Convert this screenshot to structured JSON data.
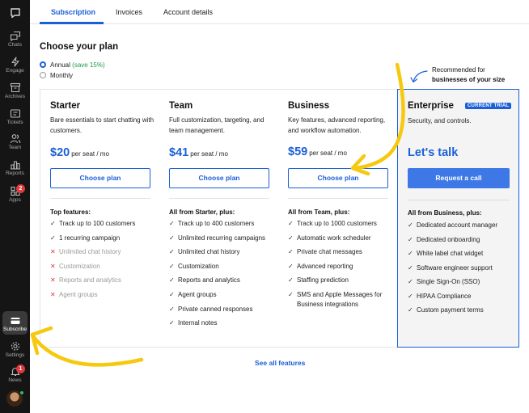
{
  "sidebar": {
    "items": [
      {
        "label": "",
        "icon": "chat-bubble-logo-icon"
      },
      {
        "label": "Chats",
        "icon": "chats-icon"
      },
      {
        "label": "Engage",
        "icon": "lightning-icon"
      },
      {
        "label": "Archives",
        "icon": "archive-icon"
      },
      {
        "label": "Tickets",
        "icon": "ticket-icon"
      },
      {
        "label": "Team",
        "icon": "team-icon"
      },
      {
        "label": "Reports",
        "icon": "bar-chart-icon"
      },
      {
        "label": "Apps",
        "icon": "apps-grid-icon",
        "badge": "2"
      },
      {
        "label": "Subscribe",
        "icon": "card-icon"
      },
      {
        "label": "Settings",
        "icon": "gear-icon"
      },
      {
        "label": "News",
        "icon": "bell-icon",
        "badge": "1"
      }
    ]
  },
  "tabs": [
    {
      "label": "Subscription",
      "active": true
    },
    {
      "label": "Invoices",
      "active": false
    },
    {
      "label": "Account details",
      "active": false
    }
  ],
  "page_title": "Choose your plan",
  "billing": {
    "annual_label": "Annual",
    "annual_save": "(save 15%)",
    "monthly_label": "Monthly",
    "selected": "annual"
  },
  "recommendation": {
    "line1": "Recommended for",
    "line2": "businesses of your size"
  },
  "plans": [
    {
      "name": "Starter",
      "description": "Bare essentials to start chatting with customers.",
      "price": "$20",
      "price_unit": "per seat / mo",
      "button": "Choose plan",
      "features_heading": "Top features:",
      "features": [
        {
          "text": "Track up to 100 customers",
          "included": true
        },
        {
          "text": "1 recurring campaign",
          "included": true
        },
        {
          "text": "Unlimited chat history",
          "included": false
        },
        {
          "text": "Customization",
          "included": false
        },
        {
          "text": "Reports and analytics",
          "included": false
        },
        {
          "text": "Agent groups",
          "included": false
        }
      ]
    },
    {
      "name": "Team",
      "description": "Full customization, targeting, and team management.",
      "price": "$41",
      "price_unit": "per seat / mo",
      "button": "Choose plan",
      "features_heading": "All from Starter, plus:",
      "features": [
        {
          "text": "Track up to 400 customers",
          "included": true
        },
        {
          "text": "Unlimited recurring campaigns",
          "included": true
        },
        {
          "text": "Unlimited chat history",
          "included": true
        },
        {
          "text": "Customization",
          "included": true
        },
        {
          "text": "Reports and analytics",
          "included": true
        },
        {
          "text": "Agent groups",
          "included": true
        },
        {
          "text": "Private canned responses",
          "included": true
        },
        {
          "text": "Internal notes",
          "included": true
        }
      ]
    },
    {
      "name": "Business",
      "description": "Key features, advanced reporting, and workflow automation.",
      "price": "$59",
      "price_unit": "per seat / mo",
      "button": "Choose plan",
      "features_heading": "All from Team, plus:",
      "features": [
        {
          "text": "Track up to 1000 customers",
          "included": true
        },
        {
          "text": "Automatic work scheduler",
          "included": true
        },
        {
          "text": "Private chat messages",
          "included": true
        },
        {
          "text": "Advanced reporting",
          "included": true
        },
        {
          "text": "Staffing prediction",
          "included": true
        },
        {
          "text": "SMS and Apple Messages for Business integrations",
          "included": true
        }
      ]
    }
  ],
  "enterprise": {
    "name": "Enterprise",
    "badge": "CURRENT TRIAL",
    "description": "Security, and controls.",
    "cta_text": "Let's talk",
    "button": "Request a call",
    "features_heading": "All from Business, plus:",
    "features": [
      "Dedicated account manager",
      "Dedicated onboarding",
      "White label chat widget",
      "Software engineer support",
      "Single Sign-On (SSO)",
      "HIPAA Compliance",
      "Custom payment terms"
    ]
  },
  "see_all_label": "See all features",
  "colors": {
    "accent": "#1b5fd8",
    "sidebar_bg": "#151515",
    "annotation_arrow": "#f6c90e",
    "badge_red": "#e0383e",
    "save_green": "#1f9a4a"
  }
}
